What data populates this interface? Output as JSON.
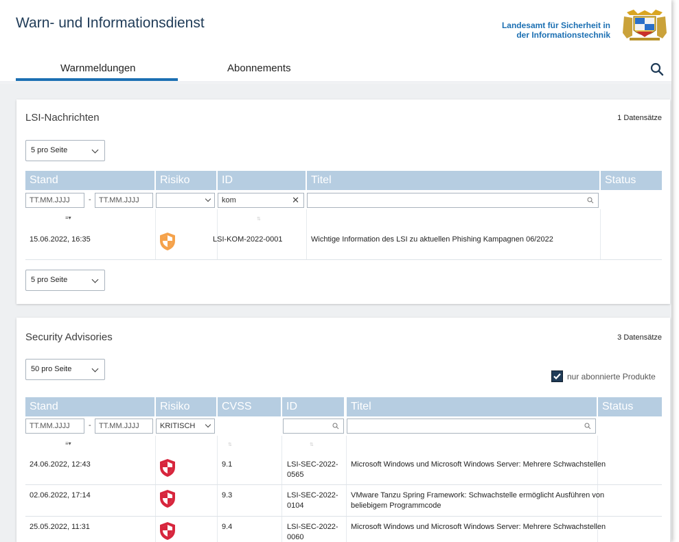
{
  "header": {
    "title": "Warn- und Informationsdienst",
    "agency_line1": "Landesamt für Sicherheit in",
    "agency_line2": "der Informationstechnik"
  },
  "nav": {
    "tabs": [
      {
        "label": "Warnmeldungen",
        "active": true
      },
      {
        "label": "Abonnements",
        "active": false
      }
    ]
  },
  "lsi": {
    "title": "LSI-Nachrichten",
    "records": "1 Datensätze",
    "page_size": "5 pro Seite",
    "page_size_bottom": "5 pro Seite",
    "columns": [
      "Stand",
      "Risiko",
      "ID",
      "Titel",
      "Status"
    ],
    "filters": {
      "date_from_placeholder": "TT.MM.JJJJ",
      "date_to_placeholder": "TT.MM.JJJJ",
      "id_value": "kom"
    },
    "rows": [
      {
        "stand": "15.06.2022, 16:35",
        "risk": "medium",
        "id": "LSI-KOM-2022-0001",
        "title": "Wichtige Information des LSI zu aktuellen Phishing Kampagnen 06/2022",
        "status": ""
      }
    ]
  },
  "advisories": {
    "title": "Security Advisories",
    "records": "3 Datensätze",
    "page_size": "50 pro Seite",
    "only_subscribed_label": "nur abonnierte Produkte",
    "only_subscribed_checked": true,
    "columns": [
      "Stand",
      "Risiko",
      "CVSS Temporal",
      "ID",
      "Titel",
      "Status"
    ],
    "filters": {
      "date_from_placeholder": "TT.MM.JJJJ",
      "date_to_placeholder": "TT.MM.JJJJ",
      "risk_value": "KRITISCH"
    },
    "rows": [
      {
        "stand": "24.06.2022, 12:43",
        "risk": "critical",
        "cvss": "9.1",
        "id_line1": "LSI-SEC-2022-",
        "id_line2": "0565",
        "title_line1": "Microsoft Windows und Microsoft Windows Server: Mehrere Schwachstellen",
        "title_line2": ""
      },
      {
        "stand": "02.06.2022, 17:14",
        "risk": "critical",
        "cvss": "9.3",
        "id_line1": "LSI-SEC-2022-",
        "id_line2": "0104",
        "title_line1": "VMware Tanzu Spring Framework: Schwachstelle ermöglicht Ausführen von",
        "title_line2": "beliebigem Programmcode"
      },
      {
        "stand": "25.05.2022, 11:31",
        "risk": "critical",
        "cvss": "9.4",
        "id_line1": "LSI-SEC-2022-",
        "id_line2": "0060",
        "title_line1": "Microsoft Windows und Microsoft Windows Server: Mehrere Schwachstellen",
        "title_line2": ""
      }
    ]
  },
  "colors": {
    "accent": "#1b6fb2",
    "header_text": "#1f3b57",
    "table_header": "#b6cde1",
    "risk_medium": "#f5a24b",
    "risk_critical": "#d7263d"
  },
  "icons": {
    "search": "search-icon",
    "crest": "coat-of-arms",
    "risk_medium": "shield-orange-icon",
    "risk_critical": "shield-red-icon"
  }
}
